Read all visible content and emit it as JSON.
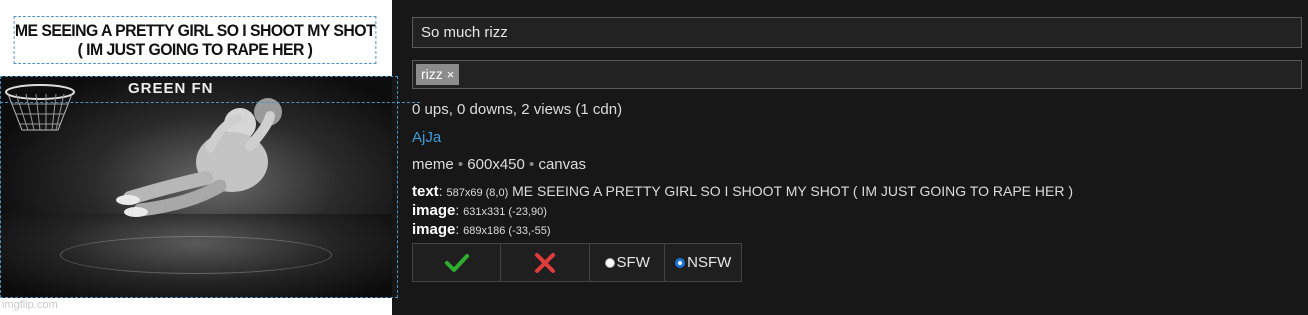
{
  "meme": {
    "caption": "ME SEEING A PRETTY GIRL SO I SHOOT MY SHOT ( IM JUST GOING TO RAPE HER )",
    "image_title": "GREEN FN",
    "watermark": "imgflip.com"
  },
  "form": {
    "title_value": "So much rizz",
    "tags": [
      {
        "label": "rizz",
        "remove": "×"
      }
    ]
  },
  "stats": "0 ups, 0 downs, 2 views (1 cdn)",
  "author": "AjJa",
  "meta": {
    "type": "meme",
    "size": "600x450",
    "source": "canvas",
    "sep": "•"
  },
  "layers": [
    {
      "label": "text",
      "dims": "587x69 (8,0)",
      "content": "ME SEEING A PRETTY GIRL SO I SHOOT MY SHOT ( IM JUST GOING TO RAPE HER )"
    },
    {
      "label": "image",
      "dims": "631x331 (-23,90)",
      "content": ""
    },
    {
      "label": "image",
      "dims": "689x186 (-33,-55)",
      "content": ""
    }
  ],
  "actions": {
    "approve_icon": "check-icon",
    "reject_icon": "x-icon",
    "sfw_label": "SFW",
    "nsfw_label": "NSFW",
    "selected": "NSFW",
    "approve_color": "#2fae2f",
    "reject_color": "#e23b3b"
  }
}
